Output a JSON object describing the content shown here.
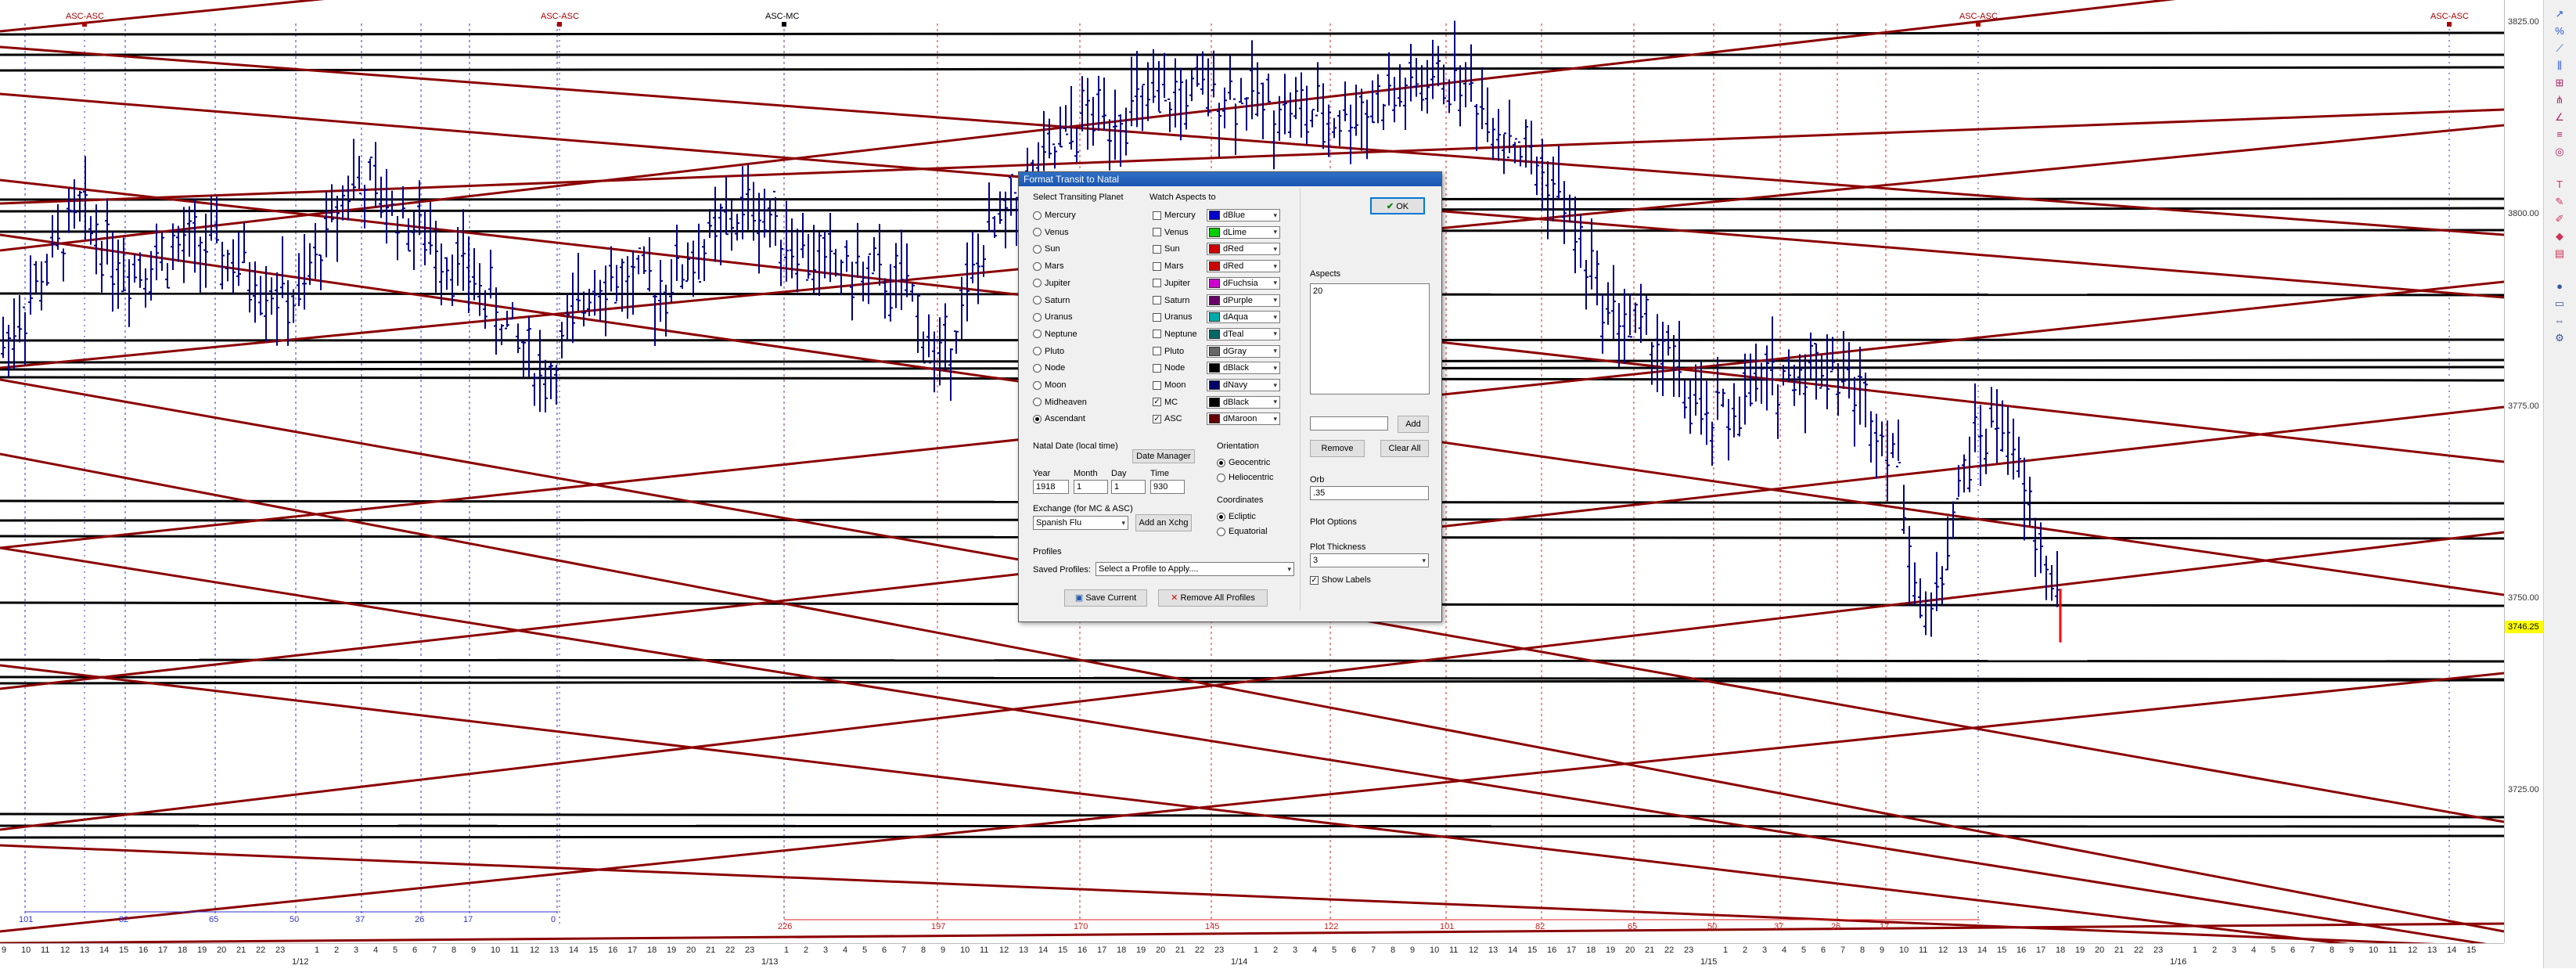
{
  "chart": {
    "price_labels": [
      "3825.00",
      "3800.00",
      "3775.00",
      "3750.00",
      "3725.00"
    ],
    "current_price": "3746.25",
    "top_markers": [
      "ASC-ASC",
      "ASC-ASC",
      "ASC-MC",
      "ASC-ASC",
      "ASC-ASC"
    ],
    "blue_counts": [
      "101",
      "82",
      "65",
      "50",
      "37",
      "26",
      "17",
      "0"
    ],
    "red_counts": [
      "226",
      "197",
      "170",
      "145",
      "122",
      "101",
      "82",
      "65",
      "50",
      "37",
      "26",
      "17"
    ],
    "hour_labels": [
      "9",
      "10",
      "11",
      "12",
      "13",
      "14",
      "15",
      "16",
      "17",
      "18",
      "19",
      "20",
      "21",
      "22",
      "23",
      "1",
      "2",
      "3",
      "4",
      "5",
      "6",
      "7",
      "8",
      "9",
      "10",
      "11",
      "12",
      "13",
      "14",
      "15",
      "16",
      "17",
      "18",
      "19",
      "20",
      "21",
      "22",
      "23",
      "1",
      "2",
      "3",
      "4",
      "5",
      "6",
      "7",
      "8",
      "9",
      "10",
      "11",
      "12",
      "13",
      "14",
      "15",
      "16",
      "17",
      "18",
      "19",
      "20",
      "21",
      "22",
      "23",
      "1",
      "2",
      "3",
      "4",
      "5",
      "6",
      "7",
      "8",
      "9",
      "10",
      "11",
      "12",
      "13",
      "14",
      "15",
      "16",
      "17",
      "18",
      "19",
      "20",
      "21",
      "22",
      "23",
      "1",
      "2",
      "3",
      "4",
      "5",
      "6",
      "7",
      "8",
      "9",
      "10",
      "11",
      "12",
      "13",
      "14",
      "15",
      "16",
      "17",
      "18",
      "19",
      "20",
      "21",
      "22",
      "23",
      "1",
      "2",
      "3",
      "4",
      "5",
      "6",
      "7",
      "8",
      "9",
      "10",
      "11",
      "12",
      "13",
      "14",
      "15"
    ],
    "date_labels": [
      "1/12",
      "1/13",
      "1/14",
      "1/15",
      "1/16"
    ],
    "colors": {
      "bar": "#00008b",
      "aspect_red": "#8b0000",
      "aspect_black": "#000000",
      "blue_dotted": "#3333cc",
      "red_dotted": "#dd2222",
      "highlight": "#ffff00"
    }
  },
  "toolbar": {
    "icons": [
      "arrow-tool-icon",
      "percent-icon",
      "trend-icon",
      "bars-icon",
      "grid-icon",
      "fan-icon",
      "angle-icon",
      "levels-icon",
      "cycle-icon",
      "text-icon",
      "pencil-icon",
      "pen-icon",
      "color-icon",
      "layers-icon",
      "node-icon",
      "box-icon",
      "measure-icon",
      "settings-icon"
    ]
  },
  "dialog": {
    "title": "Format Transit to Natal",
    "transiting_title": "Select Transiting Planet",
    "planets": [
      "Mercury",
      "Venus",
      "Sun",
      "Mars",
      "Jupiter",
      "Saturn",
      "Uranus",
      "Neptune",
      "Pluto",
      "Node",
      "Moon",
      "Midheaven",
      "Ascendant"
    ],
    "selected_planet": "Ascendant",
    "watch_title": "Watch Aspects to",
    "watch": [
      {
        "label": "Mercury",
        "checked": false,
        "color": "dBlue",
        "hex": "#0000cc"
      },
      {
        "label": "Venus",
        "checked": false,
        "color": "dLime",
        "hex": "#00cc00"
      },
      {
        "label": "Sun",
        "checked": false,
        "color": "dRed",
        "hex": "#cc0000"
      },
      {
        "label": "Mars",
        "checked": false,
        "color": "dRed",
        "hex": "#cc0000"
      },
      {
        "label": "Jupiter",
        "checked": false,
        "color": "dFuchsia",
        "hex": "#cc00cc"
      },
      {
        "label": "Saturn",
        "checked": false,
        "color": "dPurple",
        "hex": "#660066"
      },
      {
        "label": "Uranus",
        "checked": false,
        "color": "dAqua",
        "hex": "#00aaaa"
      },
      {
        "label": "Neptune",
        "checked": false,
        "color": "dTeal",
        "hex": "#006666"
      },
      {
        "label": "Pluto",
        "checked": false,
        "color": "dGray",
        "hex": "#666666"
      },
      {
        "label": "Node",
        "checked": false,
        "color": "dBlack",
        "hex": "#000000"
      },
      {
        "label": "Moon",
        "checked": false,
        "color": "dNavy",
        "hex": "#000066"
      },
      {
        "label": "MC",
        "checked": true,
        "color": "dBlack",
        "hex": "#000000"
      },
      {
        "label": "ASC",
        "checked": true,
        "color": "dMaroon",
        "hex": "#660000"
      }
    ],
    "aspects_title": "Aspects",
    "aspects_value": "20",
    "add_label": "Add",
    "remove_label": "Remove",
    "clear_all_label": "Clear All",
    "ok_label": "OK",
    "natal_title": "Natal Date (local time)",
    "date_manager_label": "Date Manager",
    "year_label": "Year",
    "month_label": "Month",
    "day_label": "Day",
    "time_label": "Time",
    "year": "1918",
    "month": "1",
    "day": "1",
    "time": "930",
    "exchange_title": "Exchange (for MC & ASC)",
    "exchange_value": "Spanish Flu",
    "add_xchg_label": "Add an Xchg",
    "orientation_title": "Orientation",
    "geocentric": "Geocentric",
    "heliocentric": "Heliocentric",
    "coordinates_title": "Coordinates",
    "ecliptic": "Ecliptic",
    "equatorial": "Equatorial",
    "orb_title": "Orb",
    "orb_value": ".35",
    "plot_options_title": "Plot Options",
    "plot_thickness_title": "Plot Thickness",
    "plot_thickness_value": "3",
    "show_labels": "Show Labels",
    "profiles_title": "Profiles",
    "saved_profiles_label": "Saved Profiles:",
    "profile_placeholder": "Select a Profile to Apply....",
    "save_current_label": "Save Current",
    "remove_all_label": "Remove All Profiles"
  }
}
